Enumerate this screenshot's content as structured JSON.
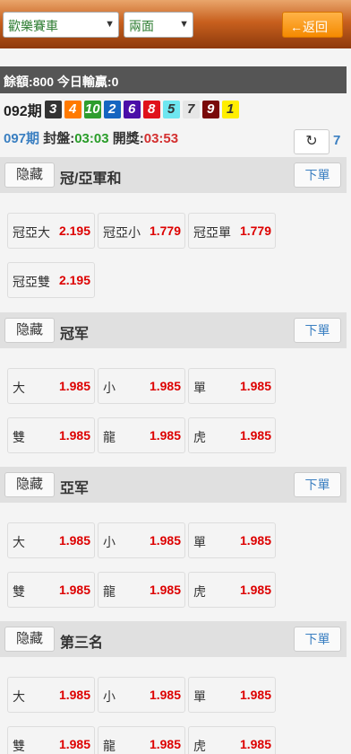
{
  "header": {
    "game_select": "歡樂賽車",
    "mode_select": "兩面",
    "back_label": "←返回"
  },
  "balance_text": "餘額:800 今日輸贏:0",
  "last_draw": {
    "label": "092期",
    "balls": [
      {
        "num": "3",
        "bg": "#333333",
        "fg": "#ffffff"
      },
      {
        "num": "4",
        "bg": "#ff7a00",
        "fg": "#ffffff"
      },
      {
        "num": "10",
        "bg": "#2e9d2e",
        "fg": "#ffffff"
      },
      {
        "num": "2",
        "bg": "#1565c0",
        "fg": "#ffffff"
      },
      {
        "num": "6",
        "bg": "#4b0fa8",
        "fg": "#ffffff"
      },
      {
        "num": "8",
        "bg": "#e0121b",
        "fg": "#ffffff"
      },
      {
        "num": "5",
        "bg": "#6ee6f0",
        "fg": "#333333"
      },
      {
        "num": "7",
        "bg": "#e6e6e6",
        "fg": "#333333"
      },
      {
        "num": "9",
        "bg": "#7a0a0a",
        "fg": "#ffffff"
      },
      {
        "num": "1",
        "bg": "#ffee00",
        "fg": "#333333"
      }
    ]
  },
  "current": {
    "period": "097期",
    "close_label": "封盤:",
    "close_time": "03:03",
    "open_label": "開獎:",
    "open_time": "03:53",
    "refresh_icon": "refresh-icon",
    "refresh_count": "7"
  },
  "hide_label": "隐藏",
  "order_label": "下單",
  "sections": [
    {
      "title": "冠/亞軍和",
      "cells": [
        {
          "label": "冠亞大",
          "odd": "2.195"
        },
        {
          "label": "冠亞小",
          "odd": "1.779"
        },
        {
          "label": "冠亞單",
          "odd": "1.779"
        },
        {
          "label": "冠亞雙",
          "odd": "2.195"
        }
      ]
    },
    {
      "title": "冠军",
      "cells": [
        {
          "label": "大",
          "odd": "1.985"
        },
        {
          "label": "小",
          "odd": "1.985"
        },
        {
          "label": "單",
          "odd": "1.985"
        },
        {
          "label": "雙",
          "odd": "1.985"
        },
        {
          "label": "龍",
          "odd": "1.985"
        },
        {
          "label": "虎",
          "odd": "1.985"
        }
      ]
    },
    {
      "title": "亞军",
      "cells": [
        {
          "label": "大",
          "odd": "1.985"
        },
        {
          "label": "小",
          "odd": "1.985"
        },
        {
          "label": "單",
          "odd": "1.985"
        },
        {
          "label": "雙",
          "odd": "1.985"
        },
        {
          "label": "龍",
          "odd": "1.985"
        },
        {
          "label": "虎",
          "odd": "1.985"
        }
      ]
    },
    {
      "title": "第三名",
      "cells": [
        {
          "label": "大",
          "odd": "1.985"
        },
        {
          "label": "小",
          "odd": "1.985"
        },
        {
          "label": "單",
          "odd": "1.985"
        },
        {
          "label": "雙",
          "odd": "1.985"
        },
        {
          "label": "龍",
          "odd": "1.985"
        },
        {
          "label": "虎",
          "odd": "1.985"
        }
      ]
    }
  ]
}
